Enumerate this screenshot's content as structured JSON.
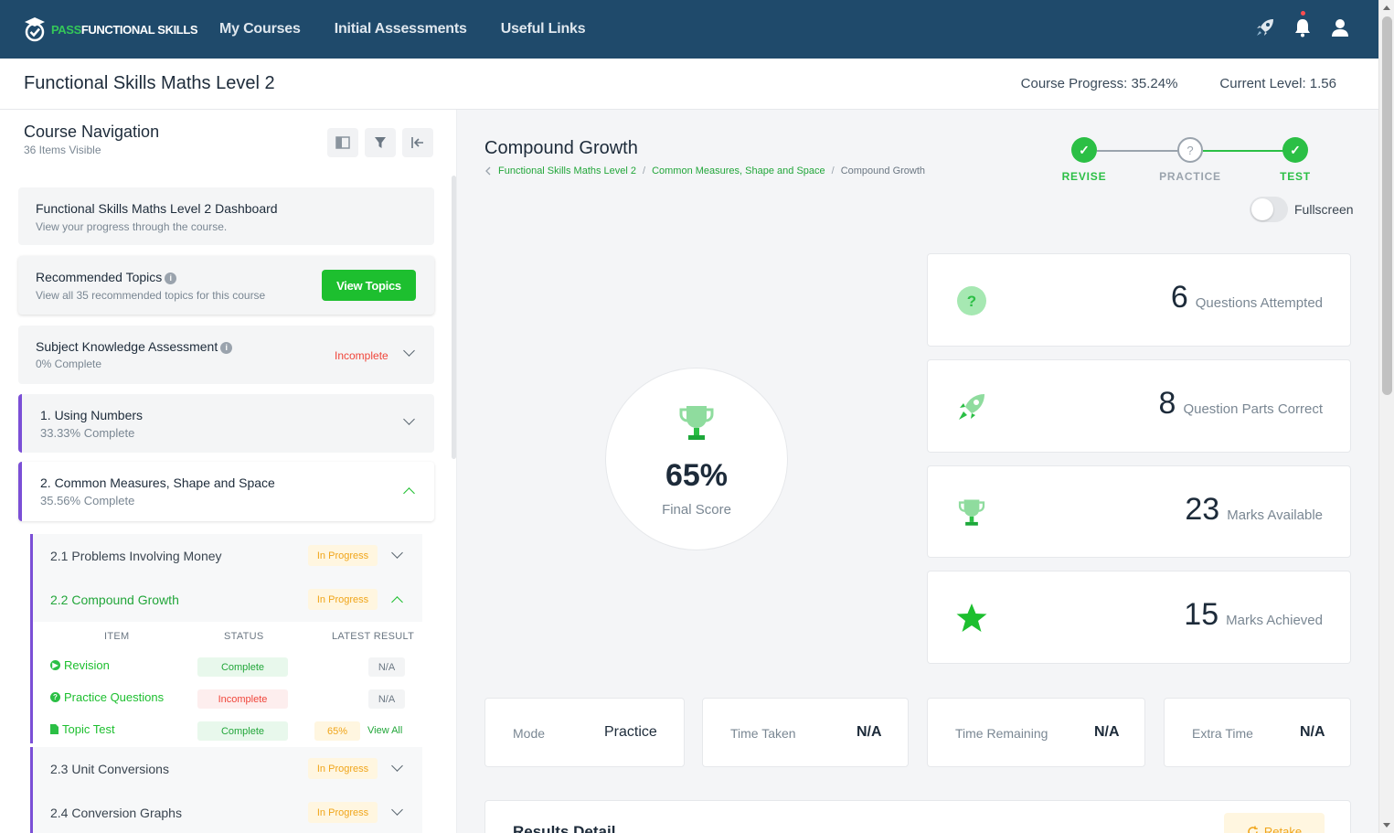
{
  "brand": {
    "pass": "PASS",
    "rest": "FUNCTIONAL SKILLS"
  },
  "nav": [
    "My Courses",
    "Initial Assessments",
    "Useful Links"
  ],
  "header": {
    "course_title": "Functional Skills Maths Level 2",
    "progress_label": "Course Progress:",
    "progress_value": "35.24%",
    "level_label": "Current Level:",
    "level_value": "1.56"
  },
  "sidebar": {
    "title": "Course Navigation",
    "subtitle": "36 Items Visible",
    "dashboard": {
      "title": "Functional Skills Maths Level 2 Dashboard",
      "desc": "View your progress through the course."
    },
    "recommended": {
      "title": "Recommended Topics",
      "desc": "View all 35 recommended topics for this course",
      "button": "View Topics"
    },
    "ska": {
      "title": "Subject Knowledge Assessment",
      "desc": "0% Complete",
      "status": "Incomplete"
    },
    "modules": [
      {
        "title": "1. Using Numbers",
        "pct": "33.33% Complete"
      },
      {
        "title": "2. Common Measures, Shape and Space",
        "pct": "35.56% Complete"
      }
    ],
    "topics": [
      {
        "name": "2.1 Problems Involving Money",
        "status": "In Progress"
      },
      {
        "name": "2.2 Compound Growth",
        "status": "In Progress"
      },
      {
        "name": "2.3 Unit Conversions",
        "status": "In Progress"
      },
      {
        "name": "2.4 Conversion Graphs",
        "status": "In Progress"
      }
    ],
    "table": {
      "headers": [
        "ITEM",
        "STATUS",
        "LATEST RESULT"
      ],
      "rows": [
        {
          "item": "Revision",
          "status": "Complete",
          "result": "N/A"
        },
        {
          "item": "Practice Questions",
          "status": "Incomplete",
          "result": "N/A"
        },
        {
          "item": "Topic Test",
          "status": "Complete",
          "result": "65%",
          "link": "View All"
        }
      ]
    }
  },
  "main": {
    "title": "Compound Growth",
    "breadcrumb": [
      "Functional Skills Maths Level 2",
      "Common Measures, Shape and Space",
      "Compound Growth"
    ],
    "steps": [
      "REVISE",
      "PRACTICE",
      "TEST"
    ],
    "fullscreen": "Fullscreen",
    "score": {
      "value": "65%",
      "label": "Final Score"
    },
    "stats": [
      {
        "num": "6",
        "label": "Questions Attempted",
        "icon": "question-icon"
      },
      {
        "num": "8",
        "label": "Question Parts Correct",
        "icon": "rocket-icon"
      },
      {
        "num": "23",
        "label": "Marks Available",
        "icon": "trophy-icon"
      },
      {
        "num": "15",
        "label": "Marks Achieved",
        "icon": "star-icon"
      }
    ],
    "meta": [
      {
        "k": "Mode",
        "v": "Practice"
      },
      {
        "k": "Time Taken",
        "v": "N/A"
      },
      {
        "k": "Time Remaining",
        "v": "N/A"
      },
      {
        "k": "Extra Time",
        "v": "N/A"
      }
    ],
    "results_title": "Results Detail",
    "retake": "Retake"
  },
  "colors": {
    "nav": "#1f4a6b",
    "accent": "#1dbf2f",
    "module_bar": "#7b4fd6",
    "warn": "#f0a51a",
    "danger": "#f0453a"
  }
}
